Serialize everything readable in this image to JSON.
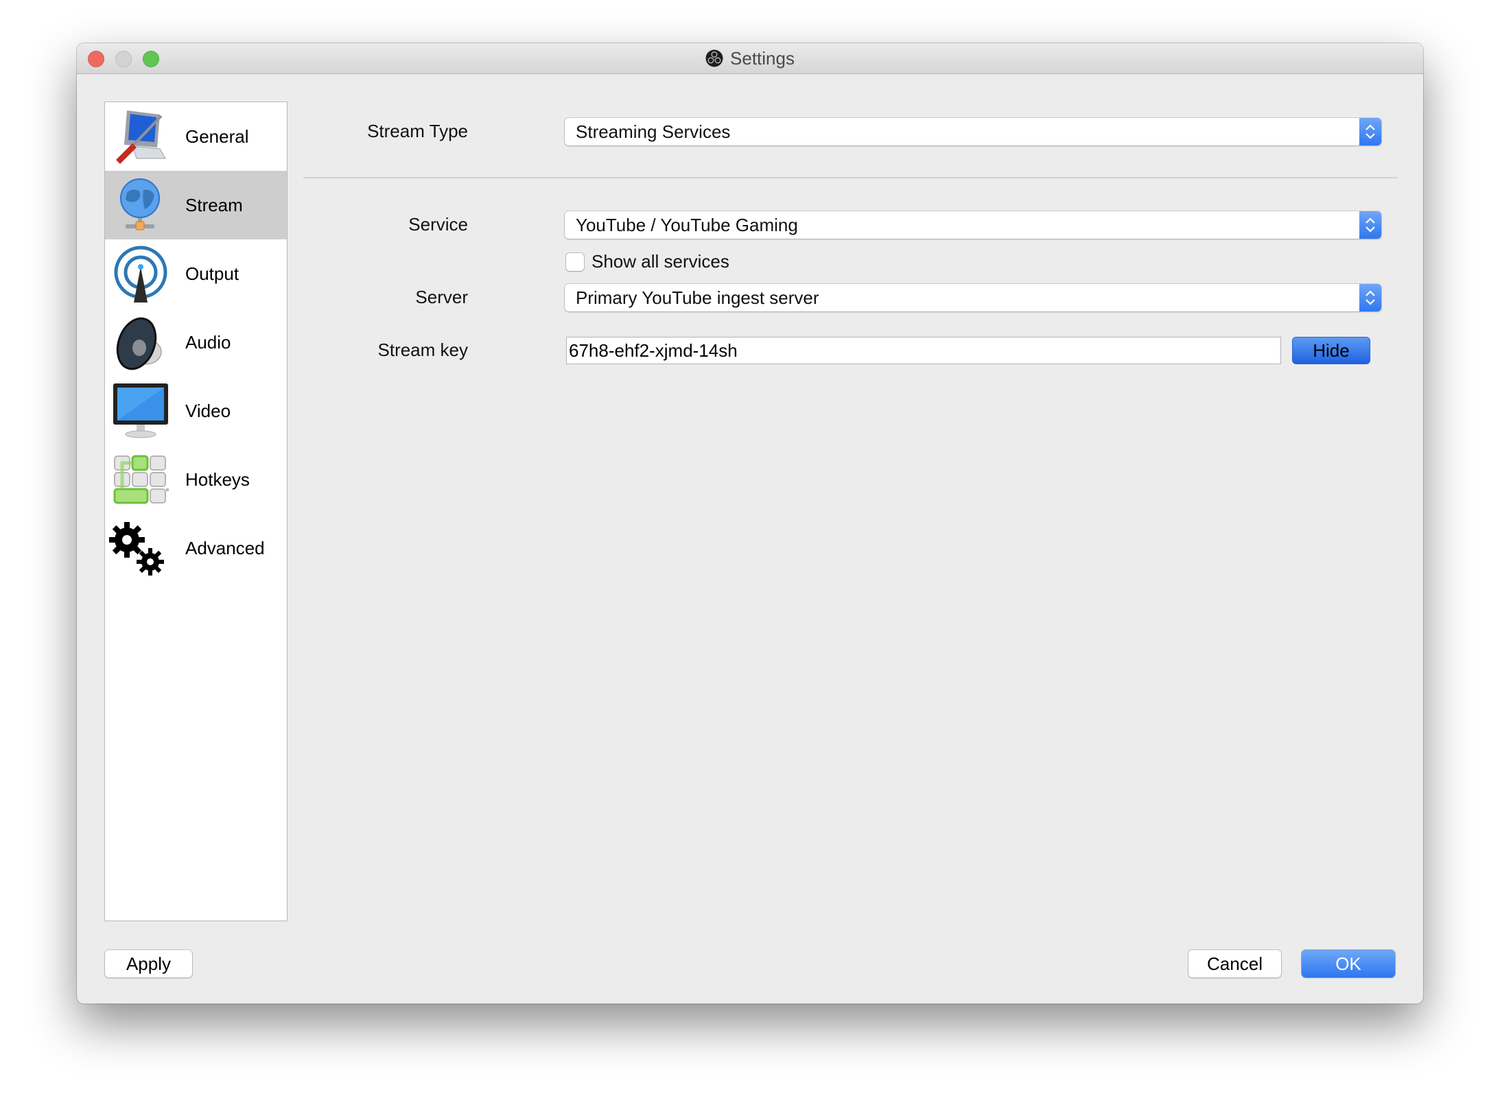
{
  "window": {
    "title": "Settings",
    "app_icon": "obs-logo-icon"
  },
  "sidebar": {
    "selected": "Stream",
    "items": [
      {
        "label": "General",
        "icon": "general-settings-icon"
      },
      {
        "label": "Stream",
        "icon": "globe-network-icon"
      },
      {
        "label": "Output",
        "icon": "broadcast-antenna-icon"
      },
      {
        "label": "Audio",
        "icon": "speaker-icon"
      },
      {
        "label": "Video",
        "icon": "monitor-icon"
      },
      {
        "label": "Hotkeys",
        "icon": "keyboard-keys-icon"
      },
      {
        "label": "Advanced",
        "icon": "gears-icon"
      }
    ]
  },
  "form": {
    "stream_type": {
      "label": "Stream Type",
      "value": "Streaming Services"
    },
    "service": {
      "label": "Service",
      "value": "YouTube / YouTube Gaming"
    },
    "show_all_services": {
      "label": "Show all services",
      "checked": false
    },
    "server": {
      "label": "Server",
      "value": "Primary YouTube ingest server"
    },
    "stream_key": {
      "label": "Stream key",
      "value": "67h8-ehf2-xjmd-14sh",
      "toggle_label": "Hide"
    }
  },
  "buttons": {
    "apply": "Apply",
    "cancel": "Cancel",
    "ok": "OK"
  },
  "colors": {
    "accent": "#2f76f0",
    "selected_row": "#cecece",
    "window_bg": "#ececec"
  }
}
